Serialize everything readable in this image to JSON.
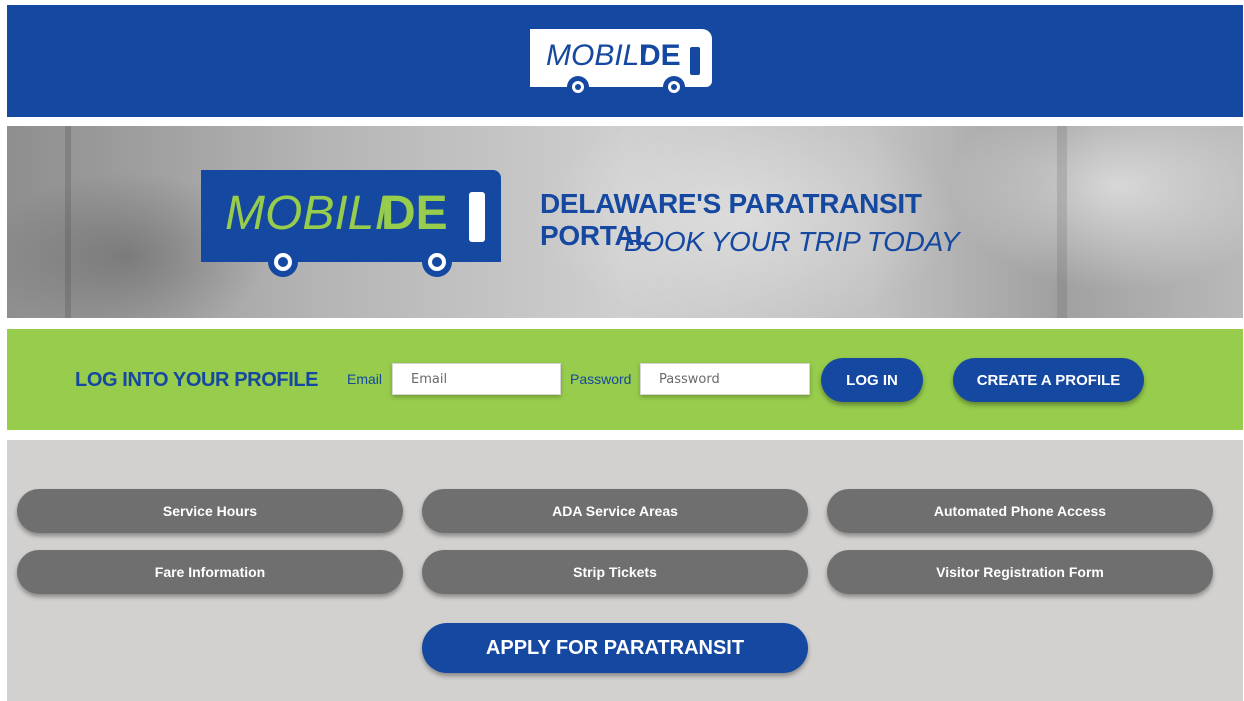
{
  "header": {
    "logo_text_a": "MOBILI",
    "logo_text_b": "DE"
  },
  "hero": {
    "logo_text_a": "MOBILI",
    "logo_text_b": "DE",
    "title": "DELAWARE'S PARATRANSIT PORTAL",
    "subtitle": "BOOK YOUR TRIP TODAY"
  },
  "login": {
    "heading": "LOG INTO YOUR PROFILE",
    "email_label": "Email",
    "email_placeholder": "Email",
    "email_value": "",
    "password_label": "Password",
    "password_placeholder": "Password",
    "password_value": "",
    "login_button": "LOG IN",
    "create_button": "CREATE A PROFILE"
  },
  "services": {
    "items": [
      {
        "label": "Service Hours"
      },
      {
        "label": "ADA Service Areas"
      },
      {
        "label": "Automated Phone Access"
      },
      {
        "label": "Fare Information"
      },
      {
        "label": "Strip Tickets"
      },
      {
        "label": "Visitor Registration Form"
      }
    ],
    "apply_button": "APPLY FOR PARATRANSIT"
  },
  "colors": {
    "brand_blue": "#1548a0",
    "brand_green": "#97cc4c",
    "service_gray": "#6f6f6f",
    "panel_gray": "#d3d1cf"
  }
}
